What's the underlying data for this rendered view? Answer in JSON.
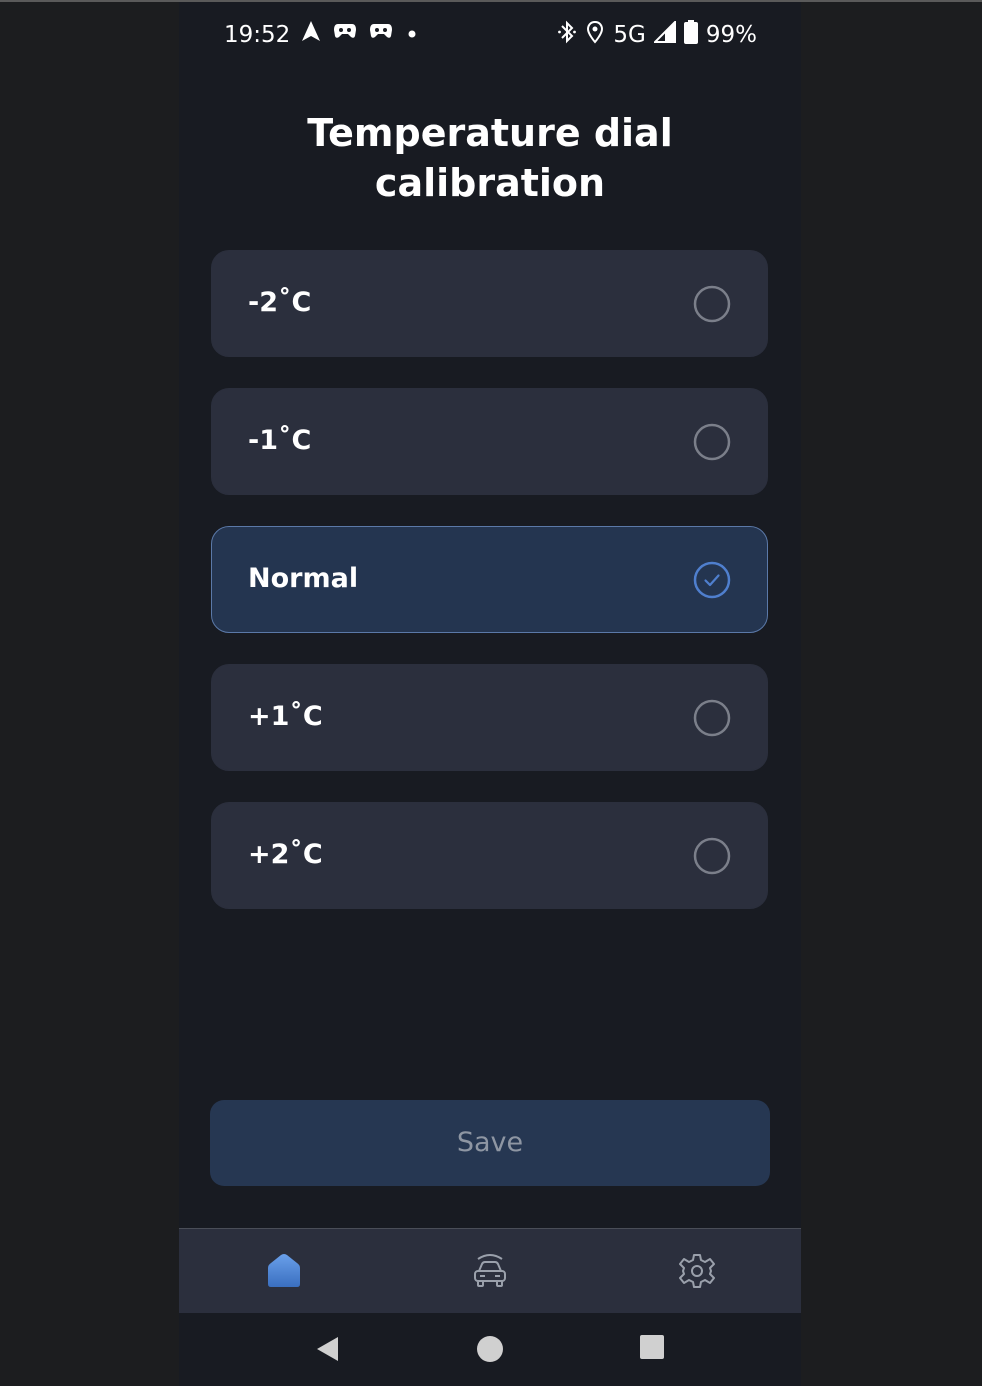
{
  "status_bar": {
    "time": "19:52",
    "network": "5G",
    "battery": "99%"
  },
  "title": "Temperature dial calibration",
  "options": [
    {
      "label": "-2˚C",
      "selected": false
    },
    {
      "label": "-1˚C",
      "selected": false
    },
    {
      "label": "Normal",
      "selected": true
    },
    {
      "label": "+1˚C",
      "selected": false
    },
    {
      "label": "+2˚C",
      "selected": false
    }
  ],
  "save_label": "Save",
  "bottom_nav": [
    {
      "icon": "home-icon",
      "active": true
    },
    {
      "icon": "car-icon",
      "active": false
    },
    {
      "icon": "gear-icon",
      "active": false
    }
  ],
  "colors": {
    "accent": "#4f7fce",
    "card": "#2b2f3d",
    "card_selected": "#243550",
    "background": "#181b22"
  }
}
